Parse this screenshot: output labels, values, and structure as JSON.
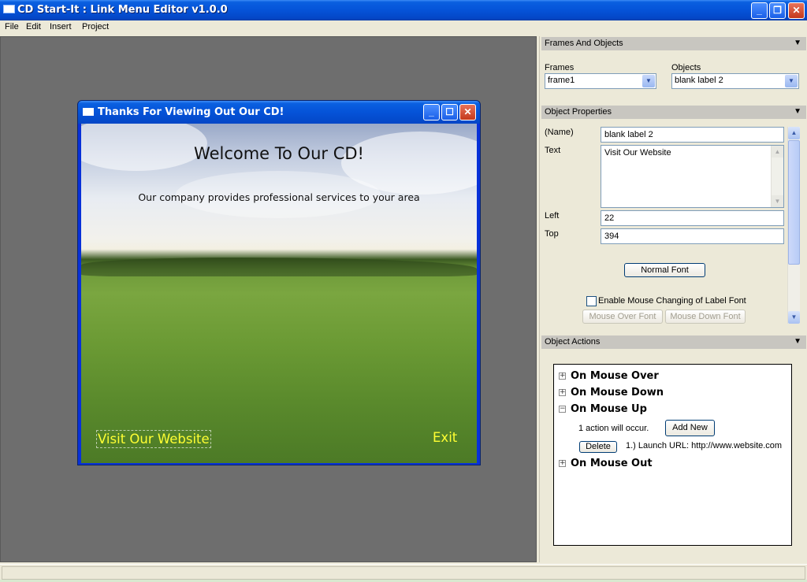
{
  "window": {
    "title": "CD Start-It : Link Menu Editor v1.0.0",
    "controls": {
      "minimize": "_",
      "maximize": "❐",
      "close": "✕"
    }
  },
  "menubar": {
    "items": [
      "File",
      "Edit",
      "Insert",
      "Project"
    ]
  },
  "preview": {
    "title": "Thanks For Viewing Out Our CD!",
    "heading": "Welcome To Our CD!",
    "tagline": "Our company provides professional services to your area",
    "link_label": "Visit Our Website",
    "exit_label": "Exit",
    "link_color": "#ffff33",
    "controls": {
      "minimize": "_",
      "maximize": "☐",
      "close": "✕"
    }
  },
  "frames_and_objects": {
    "header": "Frames And Objects",
    "frames_label": "Frames",
    "frames_value": "frame1",
    "objects_label": "Objects",
    "objects_value": "blank label 2"
  },
  "object_properties": {
    "header": "Object Properties",
    "name_label": "(Name)",
    "name_value": "blank label 2",
    "text_label": "Text",
    "text_value": "Visit Our Website",
    "left_label": "Left",
    "left_value": "22",
    "top_label": "Top",
    "top_value": "394",
    "normal_font_button": "Normal Font",
    "enable_mouse_font_label": "Enable Mouse Changing of Label Font",
    "enable_mouse_font_checked": false,
    "mouse_over_font_button": "Mouse Over Font",
    "mouse_down_font_button": "Mouse Down Font"
  },
  "object_actions": {
    "header": "Object Actions",
    "events": [
      {
        "label": "On Mouse Over",
        "expanded": false
      },
      {
        "label": "On Mouse Down",
        "expanded": false
      },
      {
        "label": "On Mouse Up",
        "expanded": true
      },
      {
        "label": "On Mouse Out",
        "expanded": false
      }
    ],
    "mouse_up_summary": "1 action will occur.",
    "add_new_button": "Add New",
    "delete_button": "Delete",
    "action_text": "1.) Launch URL:  http://www.website.com"
  },
  "icons": {
    "section_collapse": "▼",
    "dropdown": "▼",
    "scroll_up": "▲",
    "scroll_down": "▼",
    "expand": "+",
    "collapse": "−"
  },
  "colors": {
    "titlebar_blue": "#0553d8",
    "canvas_gray": "#6e6e6e",
    "panel_bg": "#ece9d8",
    "section_header": "#c8c6c0"
  }
}
